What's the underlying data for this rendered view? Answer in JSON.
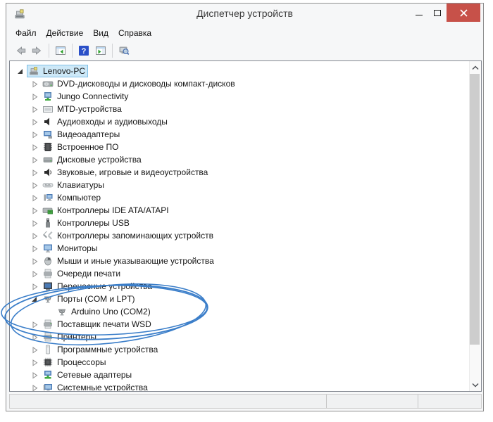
{
  "window": {
    "title": "Диспетчер устройств",
    "app_icon": "device-manager",
    "close_color": "#c75149"
  },
  "menu": {
    "items": [
      {
        "name": "file",
        "label": "Файл"
      },
      {
        "name": "action",
        "label": "Действие"
      },
      {
        "name": "view",
        "label": "Вид"
      },
      {
        "name": "help",
        "label": "Справка"
      }
    ]
  },
  "toolbar": {
    "buttons": [
      {
        "name": "back",
        "icon": "arrow-left"
      },
      {
        "name": "forward",
        "icon": "arrow-right"
      },
      {
        "type": "sep"
      },
      {
        "name": "show-console-tree",
        "icon": "console-tree"
      },
      {
        "type": "sep"
      },
      {
        "name": "help",
        "icon": "help"
      },
      {
        "name": "action-pane",
        "icon": "action-pane"
      },
      {
        "type": "sep"
      },
      {
        "name": "scan-hardware",
        "icon": "scan"
      }
    ]
  },
  "tree": {
    "items": [
      {
        "name": "lenovo-pc",
        "label": "Lenovo-PC",
        "icon": "computer",
        "level": 0,
        "state": "expanded",
        "selected": true
      },
      {
        "name": "dvd-drives",
        "label": "DVD-дисководы и дисководы компакт-дисков",
        "icon": "dvd-drive",
        "level": 1,
        "state": "collapsed"
      },
      {
        "name": "jungo-connectivity",
        "label": "Jungo Connectivity",
        "icon": "network-device",
        "level": 1,
        "state": "collapsed"
      },
      {
        "name": "mtd-devices",
        "label": "MTD-устройства",
        "icon": "mtd-device",
        "level": 1,
        "state": "collapsed"
      },
      {
        "name": "audio-io",
        "label": "Аудиовходы и аудиовыходы",
        "icon": "audio-endpoint",
        "level": 1,
        "state": "collapsed"
      },
      {
        "name": "video-adapters",
        "label": "Видеоадаптеры",
        "icon": "display-adapter",
        "level": 1,
        "state": "collapsed"
      },
      {
        "name": "firmware",
        "label": "Встроенное ПО",
        "icon": "firmware",
        "level": 1,
        "state": "collapsed"
      },
      {
        "name": "disk-devices",
        "label": "Дисковые устройства",
        "icon": "disk-drive",
        "level": 1,
        "state": "collapsed"
      },
      {
        "name": "sound-game-video",
        "label": "Звуковые, игровые и видеоустройства",
        "icon": "sound-device",
        "level": 1,
        "state": "collapsed"
      },
      {
        "name": "keyboards",
        "label": "Клавиатуры",
        "icon": "keyboard",
        "level": 1,
        "state": "collapsed"
      },
      {
        "name": "computer",
        "label": "Компьютер",
        "icon": "computer-small",
        "level": 1,
        "state": "collapsed"
      },
      {
        "name": "ide-controllers",
        "label": "Контроллеры IDE ATA/ATAPI",
        "icon": "ide-controller",
        "level": 1,
        "state": "collapsed"
      },
      {
        "name": "usb-controllers",
        "label": "Контроллеры USB",
        "icon": "usb-controller",
        "level": 1,
        "state": "collapsed"
      },
      {
        "name": "storage-controllers",
        "label": "Контроллеры запоминающих устройств",
        "icon": "storage-controller",
        "level": 1,
        "state": "collapsed"
      },
      {
        "name": "monitors",
        "label": "Мониторы",
        "icon": "monitor",
        "level": 1,
        "state": "collapsed"
      },
      {
        "name": "mice",
        "label": "Мыши и иные указывающие устройства",
        "icon": "mouse",
        "level": 1,
        "state": "collapsed"
      },
      {
        "name": "print-queues",
        "label": "Очереди печати",
        "icon": "print-queue",
        "level": 1,
        "state": "collapsed"
      },
      {
        "name": "portable-devices",
        "label": "Переносные устройства",
        "icon": "portable-device",
        "level": 1,
        "state": "collapsed"
      },
      {
        "name": "ports-com-lpt",
        "label": "Порты (COM и LPT)",
        "icon": "serial-port",
        "level": 1,
        "state": "expanded"
      },
      {
        "name": "arduino-uno-com2",
        "label": "Arduino Uno (COM2)",
        "icon": "serial-port",
        "level": 2,
        "state": "leaf"
      },
      {
        "name": "wsd-print-provider",
        "label": "Поставщик печати WSD",
        "icon": "printer",
        "level": 1,
        "state": "collapsed"
      },
      {
        "name": "printers",
        "label": "Принтеры",
        "icon": "printer",
        "level": 1,
        "state": "collapsed"
      },
      {
        "name": "software-devices",
        "label": "Программные устройства",
        "icon": "software-device",
        "level": 1,
        "state": "collapsed"
      },
      {
        "name": "processors",
        "label": "Процессоры",
        "icon": "processor",
        "level": 1,
        "state": "collapsed"
      },
      {
        "name": "network-adapters",
        "label": "Сетевые адаптеры",
        "icon": "network-adapter",
        "level": 1,
        "state": "collapsed"
      },
      {
        "name": "system-devices",
        "label": "Системные устройства",
        "icon": "system-device",
        "level": 1,
        "state": "collapsed"
      }
    ]
  },
  "annotation": {
    "shape": "hand-drawn-ellipse",
    "color": "#3b7ec9",
    "highlights": "Порты (COM и LPT) / Arduino Uno (COM2)"
  },
  "statusbar": {
    "cells": [
      "",
      "",
      ""
    ]
  }
}
